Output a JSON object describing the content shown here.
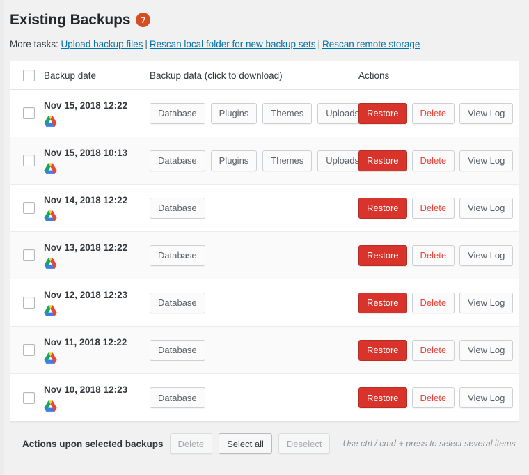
{
  "header": {
    "title": "Existing Backups",
    "badge_count": "7",
    "badge_color": "#d54e21",
    "more_tasks_label": "More tasks:",
    "separator": "|",
    "links": [
      "Upload backup files",
      "Rescan local folder for new backup sets",
      "Rescan remote storage"
    ]
  },
  "table": {
    "columns": [
      "Backup date",
      "Backup data (click to download)",
      "Actions"
    ],
    "select_all_checkbox": "unchecked",
    "rows": [
      {
        "checked": false,
        "date": "Nov 15, 2018 12:22",
        "storage_icon": "google-drive-icon",
        "data_buttons": [
          "Database",
          "Plugins",
          "Themes",
          "Uploads"
        ],
        "actions": [
          "Restore",
          "Delete",
          "View Log"
        ]
      },
      {
        "checked": false,
        "date": "Nov 15, 2018 10:13",
        "storage_icon": "google-drive-icon",
        "data_buttons": [
          "Database",
          "Plugins",
          "Themes",
          "Uploads"
        ],
        "actions": [
          "Restore",
          "Delete",
          "View Log"
        ]
      },
      {
        "checked": false,
        "date": "Nov 14, 2018 12:22",
        "storage_icon": "google-drive-icon",
        "data_buttons": [
          "Database"
        ],
        "actions": [
          "Restore",
          "Delete",
          "View Log"
        ]
      },
      {
        "checked": false,
        "date": "Nov 13, 2018 12:22",
        "storage_icon": "google-drive-icon",
        "data_buttons": [
          "Database"
        ],
        "actions": [
          "Restore",
          "Delete",
          "View Log"
        ]
      },
      {
        "checked": false,
        "date": "Nov 12, 2018 12:23",
        "storage_icon": "google-drive-icon",
        "data_buttons": [
          "Database"
        ],
        "actions": [
          "Restore",
          "Delete",
          "View Log"
        ]
      },
      {
        "checked": false,
        "date": "Nov 11, 2018 12:22",
        "storage_icon": "google-drive-icon",
        "data_buttons": [
          "Database"
        ],
        "actions": [
          "Restore",
          "Delete",
          "View Log"
        ]
      },
      {
        "checked": false,
        "date": "Nov 10, 2018 12:23",
        "storage_icon": "google-drive-icon",
        "data_buttons": [
          "Database"
        ],
        "actions": [
          "Restore",
          "Delete",
          "View Log"
        ]
      }
    ]
  },
  "footer": {
    "label": "Actions upon selected backups",
    "delete_label": "Delete",
    "delete_enabled": false,
    "select_all_label": "Select all",
    "select_all_enabled": true,
    "deselect_label": "Deselect",
    "deselect_enabled": false,
    "hint": "Use ctrl / cmd + press to select several items"
  },
  "colors": {
    "restore_button": "#d9342b",
    "delete_text": "#e8453c",
    "link": "#0073aa",
    "badge": "#d54e21"
  }
}
